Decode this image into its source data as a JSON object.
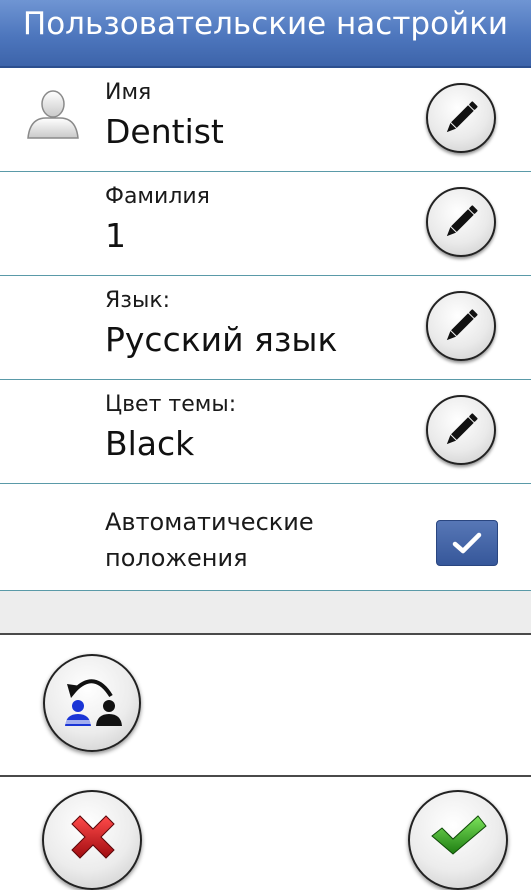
{
  "header": {
    "title": "Пользовательские настройки"
  },
  "fields": [
    {
      "label": "Имя",
      "value": "Dentist",
      "icon": "pencil-icon"
    },
    {
      "label": "Фамилия",
      "value": "1",
      "icon": "pencil-icon"
    },
    {
      "label": "Язык:",
      "value": "Русский язык",
      "icon": "pencil-icon"
    },
    {
      "label": "Цвет темы:",
      "value": "Black",
      "icon": "pencil-icon"
    }
  ],
  "auto_positions": {
    "label_line1": "Автоматические",
    "label_line2": "положения",
    "checked": true
  },
  "icons": {
    "avatar": "user-icon",
    "profile_switch": "switch-profile-icon",
    "cancel": "cross-icon",
    "confirm": "checkmark-icon"
  },
  "colors": {
    "header": "#4d76bd",
    "checkbox": "#4566a8",
    "cancel": "#c0141a",
    "confirm": "#2f9a1c"
  }
}
